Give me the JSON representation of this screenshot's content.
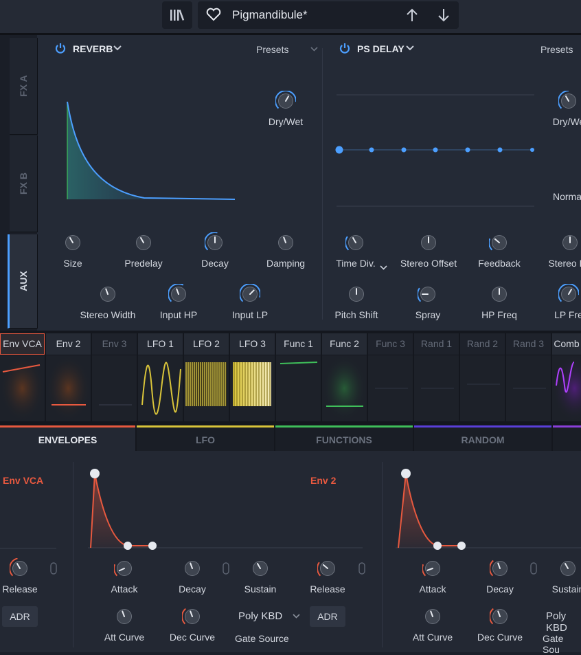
{
  "header": {
    "preset_name": "Pigmandibule*",
    "icons": [
      "library-icon",
      "heart-icon",
      "arrow-up-icon",
      "arrow-down-icon"
    ]
  },
  "fx_tabs": [
    {
      "label": "FX A",
      "active": false
    },
    {
      "label": "FX B",
      "active": false
    },
    {
      "label": "AUX",
      "active": true
    }
  ],
  "reverb": {
    "title": "REVERB",
    "presets_label": "Presets",
    "drywet_label": "Dry/Wet",
    "knobs_row1": [
      "Size",
      "Predelay",
      "Decay",
      "Damping"
    ],
    "knobs_row2": [
      "Stereo Width",
      "Input HP",
      "Input LP"
    ]
  },
  "delay": {
    "title": "PS DELAY",
    "presets_label": "Presets",
    "drywet_label": "Dry/We",
    "mode_label": "Norma",
    "knobs_row1": [
      "Time Div.",
      "Stereo Offset",
      "Feedback",
      "Stereo De"
    ],
    "knobs_row2": [
      "Pitch Shift",
      "Spray",
      "HP Freq",
      "LP Fre"
    ]
  },
  "mod_tabs": [
    {
      "label": "Env VCA",
      "dim": false
    },
    {
      "label": "Env 2",
      "dim": false
    },
    {
      "label": "Env 3",
      "dim": true
    },
    {
      "label": "LFO 1",
      "dim": false
    },
    {
      "label": "LFO 2",
      "dim": false
    },
    {
      "label": "LFO 3",
      "dim": false
    },
    {
      "label": "Func 1",
      "dim": false
    },
    {
      "label": "Func 2",
      "dim": false
    },
    {
      "label": "Func 3",
      "dim": true
    },
    {
      "label": "Rand 1",
      "dim": true
    },
    {
      "label": "Rand 2",
      "dim": true
    },
    {
      "label": "Rand 3",
      "dim": true
    },
    {
      "label": "Comb",
      "dim": false
    }
  ],
  "categories": [
    {
      "label": "ENVELOPES",
      "color": "#e8593f",
      "active": true
    },
    {
      "label": "LFO",
      "color": "#d9c43a",
      "active": false
    },
    {
      "label": "FUNCTIONS",
      "color": "#3fbf5a",
      "active": false
    },
    {
      "label": "RANDOM",
      "color": "#5a3fd9",
      "active": false
    }
  ],
  "env_vca": {
    "title": "Env VCA",
    "release_label": "Release",
    "mode_button": "ADR"
  },
  "env2": {
    "title": "Env 2",
    "knobs_row1": [
      "Attack",
      "Decay",
      "Sustain",
      "Release"
    ],
    "knobs_row2": [
      "Att Curve",
      "Dec Curve"
    ],
    "gate_source_value": "Poly KBD",
    "gate_source_label": "Gate Source",
    "mode_button": "ADR"
  },
  "env3_partial": {
    "knobs_row1": [
      "Attack",
      "Decay",
      "Sustain"
    ],
    "knobs_row2": [
      "Att Curve",
      "Dec Curve"
    ],
    "gate_source_value": "Poly KBD",
    "gate_source_label": "Gate Sou"
  },
  "colors": {
    "accent_blue": "#4c9fff",
    "env_red": "#e8593f",
    "lfo_yellow": "#d9c43a",
    "func_green": "#3fbf5a",
    "random_purple": "#5a3fd9"
  }
}
